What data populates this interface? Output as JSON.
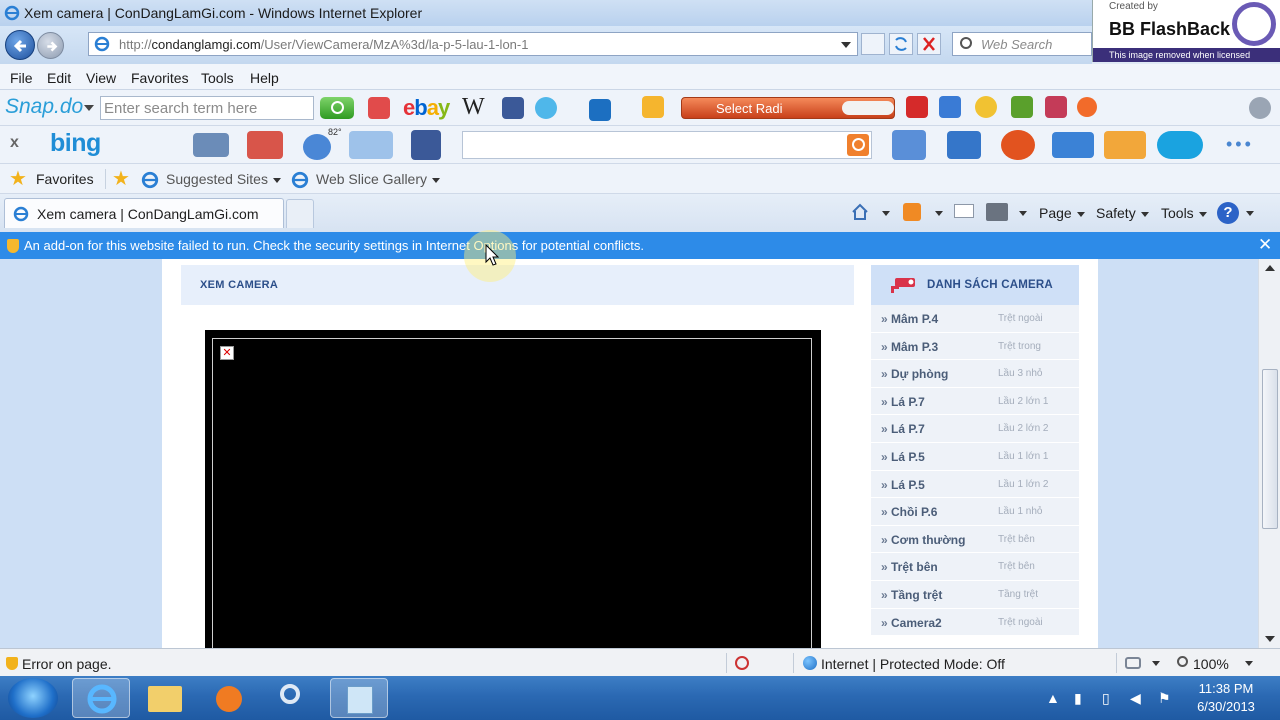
{
  "window": {
    "title": "Xem camera | ConDangLamGi.com - Windows Internet Explorer"
  },
  "watermark": {
    "created_by": "Created by",
    "brand": "BB FlashBack",
    "notice": "This image removed when licensed"
  },
  "address_bar": {
    "url_prefix": "http://",
    "url_host": "condanglamgi.com",
    "url_path": "/User/ViewCamera/MzA%3d/la-p-5-lau-1-lon-1"
  },
  "web_search": {
    "placeholder": "Web Search"
  },
  "menu": [
    "File",
    "Edit",
    "View",
    "Favorites",
    "Tools",
    "Help"
  ],
  "snap_toolbar": {
    "logo": "Snap.do",
    "search_placeholder": "Enter search term here",
    "radio_label": "Select Radi"
  },
  "bing_bar": {
    "close": "x",
    "logo": "bing",
    "weather": "82°"
  },
  "favorites_bar": {
    "favorites": "Favorites",
    "suggested_sites": "Suggested Sites",
    "web_slice_gallery": "Web Slice Gallery"
  },
  "tab": {
    "label": "Xem camera | ConDangLamGi.com"
  },
  "command_bar": {
    "page": "Page",
    "safety": "Safety",
    "tools": "Tools",
    "help": "?"
  },
  "info_bar": {
    "message": "An add-on for this website failed to run. Check the security settings in Internet Options for potential conflicts.",
    "close": "✕"
  },
  "page": {
    "section_title": "XEM CAMERA",
    "sidebar_title": "DANH SÁCH CAMERA",
    "cameras": [
      {
        "name": "Mâm P.4",
        "location": "Trệt ngoài"
      },
      {
        "name": "Mâm P.3",
        "location": "Trệt trong"
      },
      {
        "name": "Dự phòng",
        "location": "Lầu 3 nhỏ"
      },
      {
        "name": "Lá P.7",
        "location": "Lầu 2 lớn 1"
      },
      {
        "name": "Lá P.7",
        "location": "Lầu 2 lớn 2"
      },
      {
        "name": "Lá P.5",
        "location": "Lầu 1 lớn 1"
      },
      {
        "name": "Lá P.5",
        "location": "Lầu 1 lớn 2"
      },
      {
        "name": "Chồi P.6",
        "location": "Lầu 1 nhỏ"
      },
      {
        "name": "Cơm thường",
        "location": "Trệt bên"
      },
      {
        "name": "Trệt bên",
        "location": "Trệt bên"
      },
      {
        "name": "Tầng trệt",
        "location": "Tầng trệt"
      },
      {
        "name": "Camera2",
        "location": "Trệt ngoài"
      }
    ]
  },
  "status_bar": {
    "error": "Error on page.",
    "zone": "Internet | Protected Mode: Off",
    "zoom": "100%"
  },
  "clock": {
    "time": "11:38 PM",
    "date": "6/30/2013"
  },
  "colors": {
    "info_bar": "#2d8be8",
    "heading_text": "#2c4f8a",
    "taskbar": "#2b69b3"
  }
}
